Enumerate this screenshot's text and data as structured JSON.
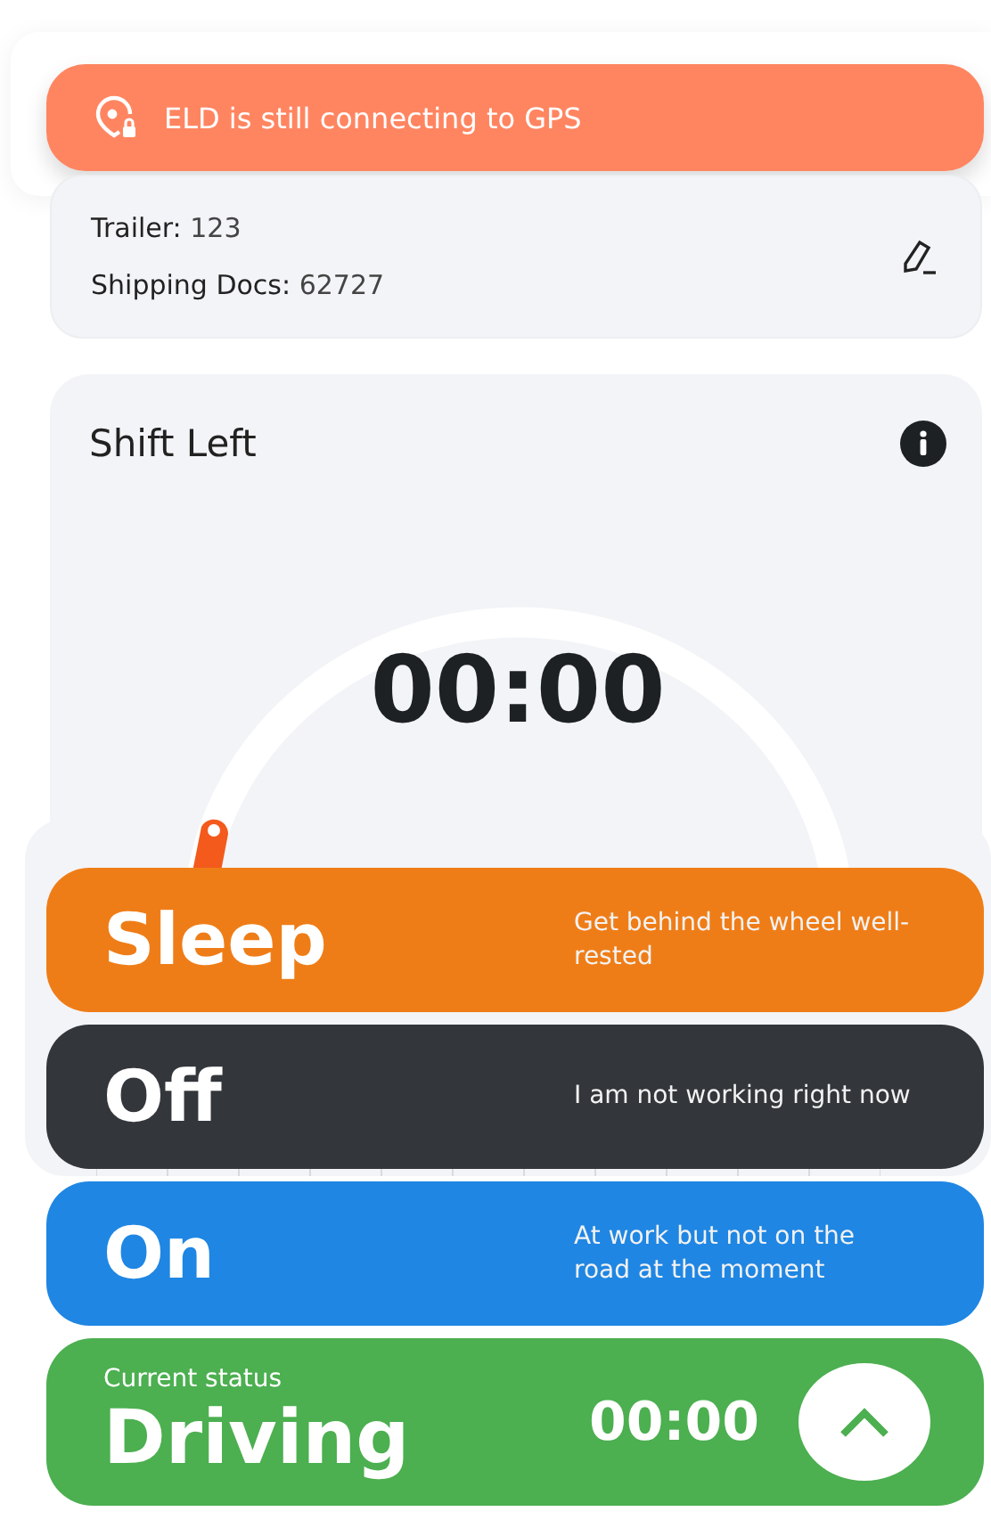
{
  "alert": {
    "text": "ELD is still connecting to GPS"
  },
  "load_info": {
    "fields": [
      {
        "label": "Trailer:",
        "value": "123"
      },
      {
        "label": "Shipping Docs:",
        "value": "62727"
      }
    ]
  },
  "shift": {
    "title": "Shift Left",
    "time": "00:00"
  },
  "status_options": [
    {
      "name": "Sleep",
      "description": "Get behind the wheel well-rested",
      "color": "#ef7d17"
    },
    {
      "name": "Off",
      "description": "I am not working right now",
      "color": "#33363a"
    },
    {
      "name": "On",
      "description": "At work but not on the road at the moment",
      "color": "#1f86e3"
    }
  ],
  "current_status": {
    "label": "Current status",
    "name": "Driving",
    "time": "00:00",
    "color": "#4caf50"
  }
}
